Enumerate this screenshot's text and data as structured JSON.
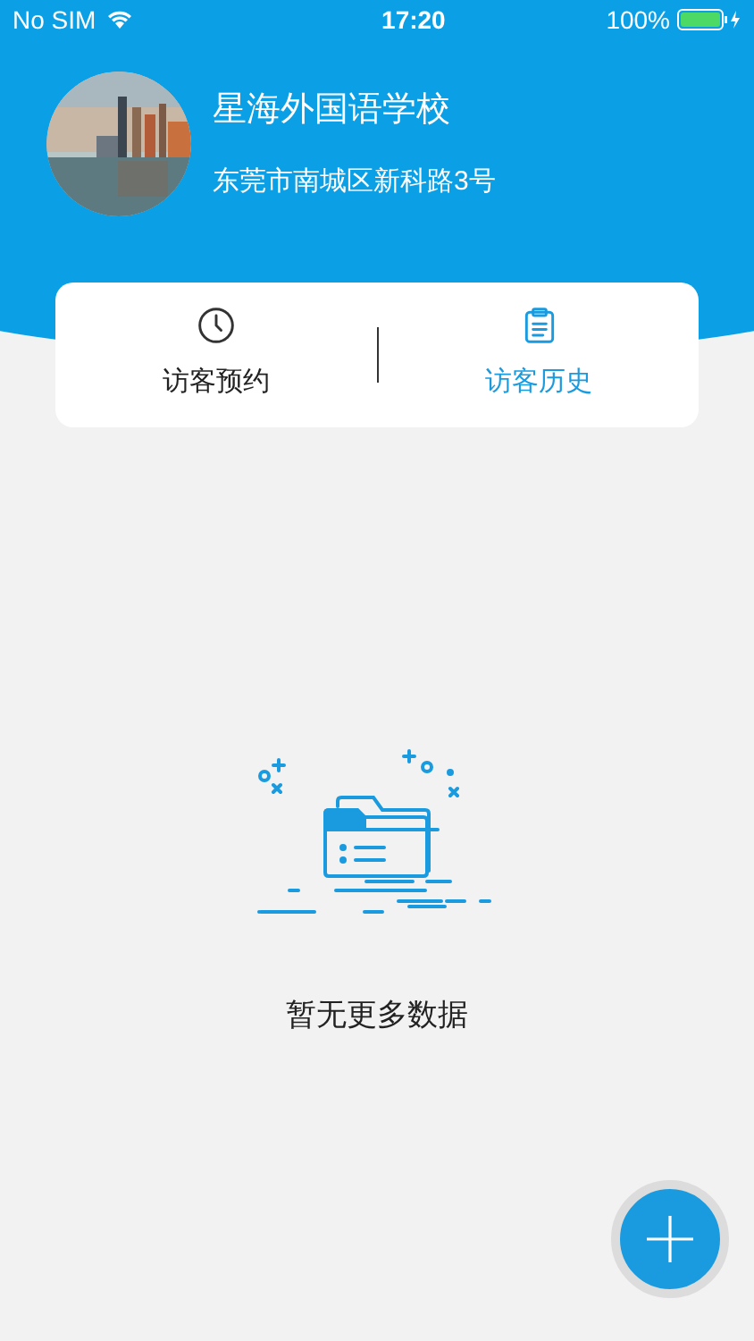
{
  "status_bar": {
    "carrier": "No SIM",
    "time": "17:20",
    "battery": "100%"
  },
  "school": {
    "name": "星海外国语学校",
    "address": "东莞市南城区新科路3号"
  },
  "tabs": [
    {
      "label": "访客预约",
      "kind": "clock",
      "selected": false
    },
    {
      "label": "访客历史",
      "kind": "clipboard",
      "selected": true
    }
  ],
  "empty_state": {
    "message": "暂无更多数据"
  }
}
